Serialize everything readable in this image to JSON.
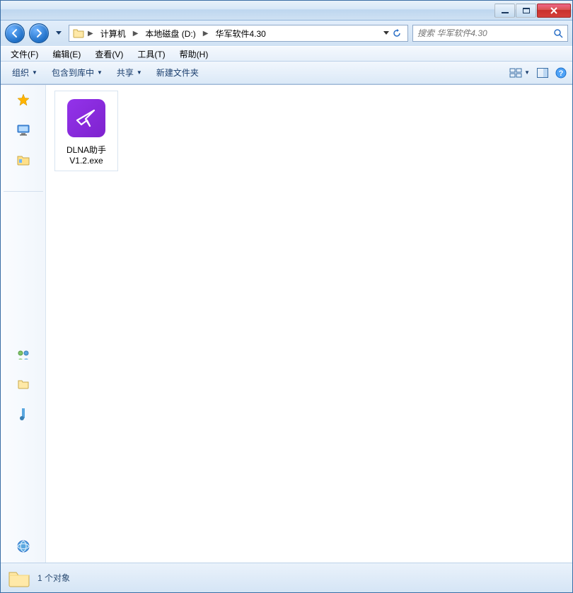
{
  "titlebar": {
    "min": "minimize",
    "max": "maximize",
    "close": "close"
  },
  "breadcrumb": {
    "root": "计算机",
    "drive": "本地磁盘 (D:)",
    "folder": "华军软件4.30"
  },
  "search": {
    "placeholder": "搜索 华军软件4.30"
  },
  "menubar": {
    "file": "文件(F)",
    "edit": "编辑(E)",
    "view": "查看(V)",
    "tools": "工具(T)",
    "help": "帮助(H)"
  },
  "toolbar": {
    "org": "组织",
    "include": "包含到库中",
    "share": "共享",
    "new": "新建文件夹"
  },
  "file": {
    "name_line1": "DLNA助手",
    "name_line2": "V1.2.exe"
  },
  "status": {
    "count": "1 个对象"
  }
}
